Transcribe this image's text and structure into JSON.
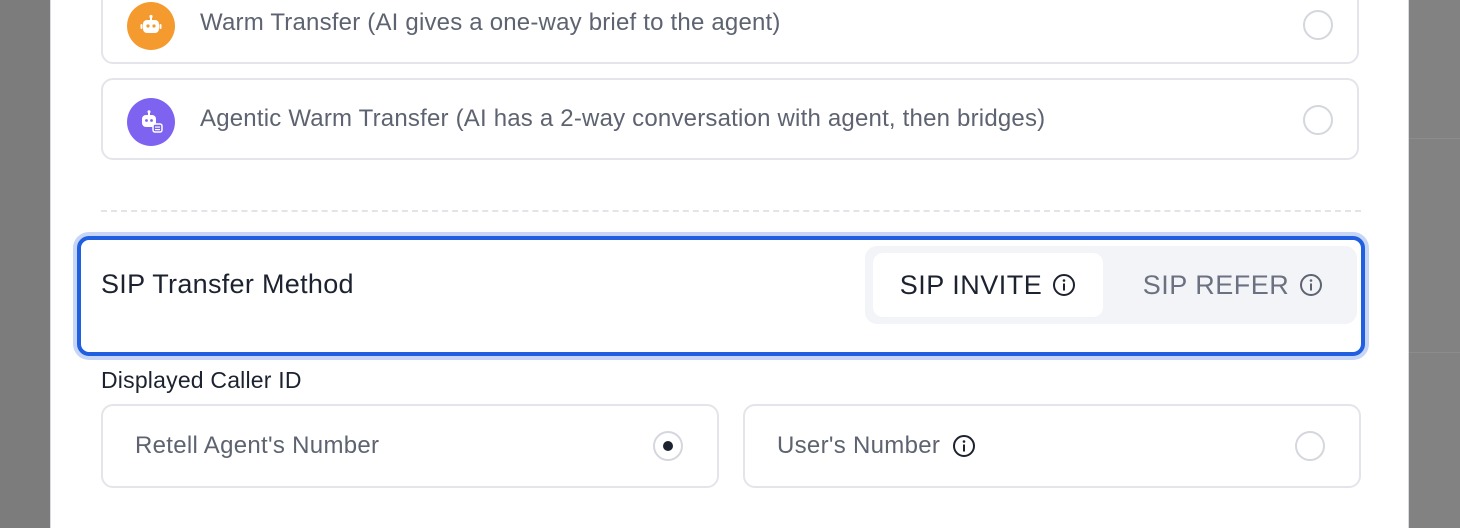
{
  "transfer_options": [
    {
      "label": "Warm Transfer (AI gives a one-way brief to the agent)",
      "icon": "robot-icon",
      "icon_color": "#f59a2f",
      "selected": false
    },
    {
      "label": "Agentic Warm Transfer (AI has a 2-way conversation with agent, then bridges)",
      "icon": "robot-chat-icon",
      "icon_color": "#7d63f0",
      "selected": false
    }
  ],
  "sip_transfer": {
    "title": "SIP Transfer Method",
    "options": [
      {
        "label": "SIP INVITE",
        "icon": "info-icon",
        "active": true
      },
      {
        "label": "SIP REFER",
        "icon": "info-icon",
        "active": false
      }
    ],
    "highlight_color": "#1f5fe0"
  },
  "caller_id": {
    "label": "Displayed Caller ID",
    "options": [
      {
        "label": "Retell Agent's Number",
        "selected": true
      },
      {
        "label": "User's Number",
        "icon": "info-icon",
        "selected": false
      }
    ]
  }
}
